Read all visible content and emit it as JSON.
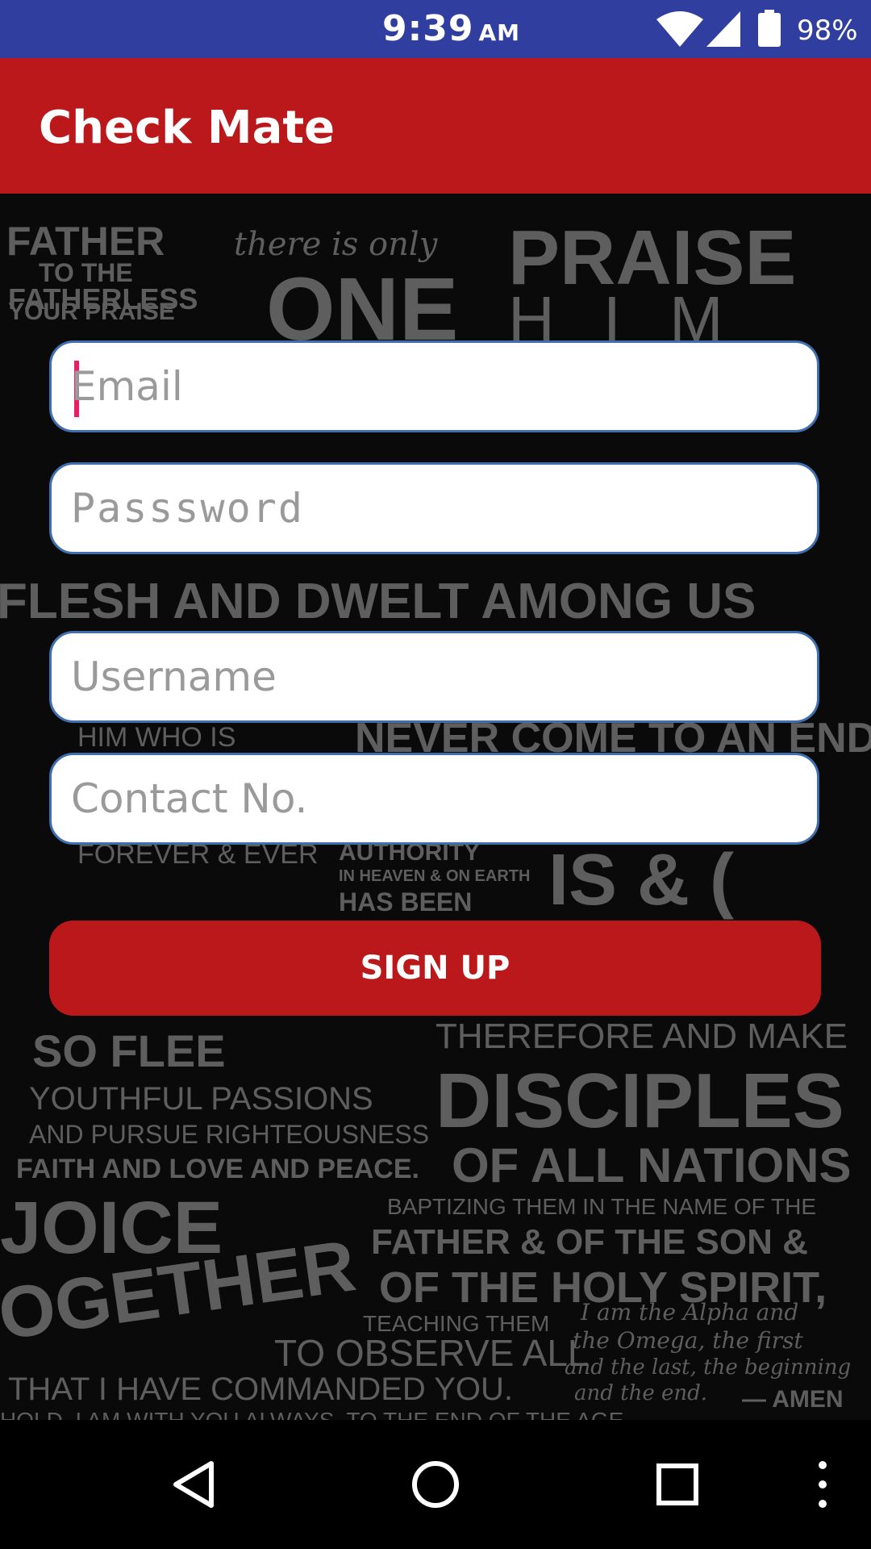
{
  "status_bar": {
    "time": "9:39",
    "ampm": "AM",
    "battery_percent": "98%"
  },
  "app_bar": {
    "title": "Check Mate"
  },
  "background_text": {
    "praise": "PRAISE",
    "him": "HIM",
    "father": "FATHER",
    "to_the": "TO THE",
    "fatherless": "FATHERLESS",
    "your_praise": "YOUR PRAISE",
    "there_is_only": "there is only",
    "one": "ONE",
    "flesh_line": "FLESH AND DWELT AMONG US",
    "never_come": "NEVER COME TO AN END",
    "him_who_is": "HIM WHO IS",
    "forever": "FOREVER & EVER",
    "authority": "AUTHORITY",
    "heaven_earth": "IN HEAVEN & ON EARTH",
    "has_been": "HAS BEEN",
    "is_and": "IS & (",
    "therefore": "THEREFORE AND MAKE",
    "disciples": "DISCIPLES",
    "so_flee": "SO FLEE",
    "youthful": "YOUTHFUL PASSIONS",
    "pursue": "AND PURSUE RIGHTEOUSNESS",
    "faith": "FAITH AND LOVE AND PEACE.",
    "of_all_nations": "OF ALL NATIONS",
    "baptizing": "BAPTIZING THEM IN THE NAME OF THE",
    "father_son": "FATHER & OF THE SON &",
    "holy_spirit": "OF THE HOLY SPIRIT,",
    "rejoice": "JOICE",
    "together": "OGETHER",
    "teaching": "TEACHING THEM",
    "observe": "TO OBSERVE ALL",
    "commanded": "THAT I HAVE COMMANDED YOU.",
    "always": "HOLD, I AM WITH YOU ALWAYS, TO THE END OF THE AGE.",
    "alpha": "I am the Alpha and",
    "omega": "the Omega, the first",
    "last": "and the last, the beginning",
    "end": "and the end.",
    "amen": "— AMEN"
  },
  "form": {
    "email_placeholder": "Email",
    "password_placeholder": "Passsword",
    "username_placeholder": "Username",
    "contact_placeholder": "Contact No.",
    "signup_label": "SIGN UP"
  },
  "colors": {
    "status_bar": "#303F9F",
    "app_bar": "#BA181B",
    "accent": "#E91E63"
  },
  "nav_bar": {
    "back_icon": "back-icon",
    "home_icon": "home-icon",
    "recents_icon": "recents-icon",
    "more_icon": "more-icon"
  }
}
